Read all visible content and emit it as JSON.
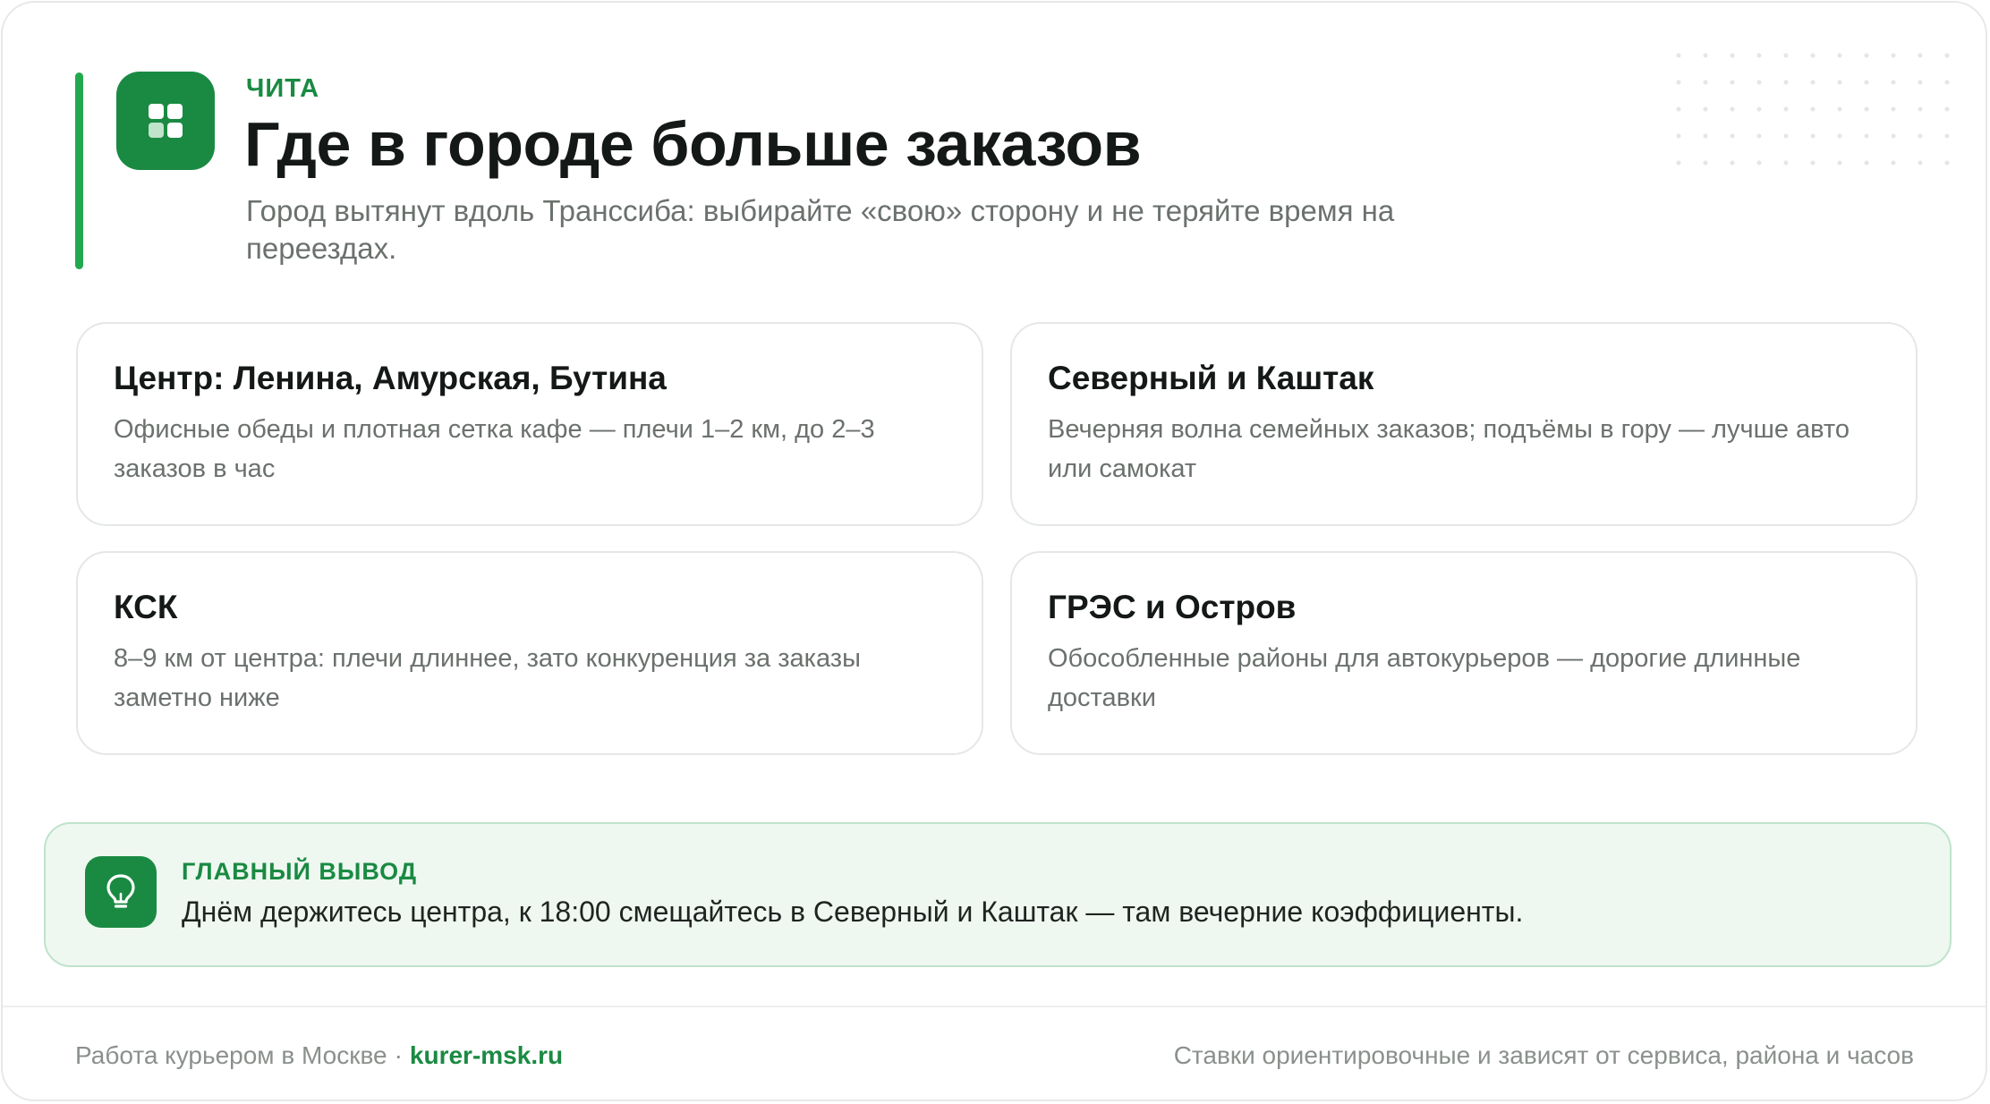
{
  "header": {
    "city": "ЧИТА",
    "title": "Где в городе больше заказов",
    "subtitle": "Город вытянут вдоль Транссиба: выбирайте «свою» сторону и не теряйте время на переездах.",
    "icon": "grid-icon"
  },
  "zones": [
    {
      "name": "Центр: Ленина, Амурская, Бутина",
      "description": "Офисные обеды и плотная сетка кафе — плечи 1–2 км, до 2–3 заказов в час"
    },
    {
      "name": "Северный и Каштак",
      "description": "Вечерняя волна семейных заказов; подъёмы в гору — лучше авто или самокат"
    },
    {
      "name": "КСК",
      "description": "8–9 км от центра: плечи длиннее, зато конкуренция за заказы заметно ниже"
    },
    {
      "name": "ГРЭС и Остров",
      "description": "Обособленные районы для автокурьеров — дорогие длинные доставки"
    }
  ],
  "takeaway": {
    "label": "ГЛАВНЫЙ ВЫВОД",
    "text": "Днём держитесь центра, к 18:00 смещайтесь в Северный и Каштак — там вечерние коэффициенты.",
    "icon": "lightbulb-icon"
  },
  "footer": {
    "left_text": "Работа курьером в Москве",
    "separator": "·",
    "site": "kurer-msk.ru",
    "right_text": "Ставки ориентировочные и зависят от сервиса, района и часов"
  },
  "colors": {
    "brand_green": "#1a8a42",
    "accent_bar": "#22a94f",
    "takeaway_bg": "#eef8f1",
    "takeaway_border": "#bfe3cb"
  }
}
